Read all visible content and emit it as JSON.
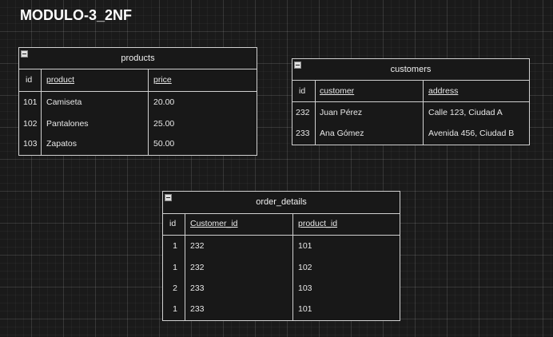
{
  "diagram_title": "MODULO-3_2NF",
  "tables": {
    "products": {
      "name": "products",
      "columns": [
        "id",
        "product",
        "price"
      ],
      "rows": [
        [
          "101",
          "Camiseta",
          "20.00"
        ],
        [
          "102",
          "Pantalones",
          "25.00"
        ],
        [
          "103",
          "Zapatos",
          "50.00"
        ]
      ]
    },
    "customers": {
      "name": "customers",
      "columns": [
        "id",
        "customer",
        "address"
      ],
      "rows": [
        [
          "232",
          "Juan Pérez",
          "Calle 123, Ciudad A"
        ],
        [
          "233",
          "Ana Gómez",
          "Avenida 456, Ciudad B"
        ]
      ]
    },
    "order_details": {
      "name": "order_details",
      "columns": [
        "id",
        "Customer_id",
        "product_id"
      ],
      "rows": [
        [
          "1",
          "232",
          "101"
        ],
        [
          "1",
          "232",
          "102"
        ],
        [
          "2",
          "233",
          "103"
        ],
        [
          "1",
          "233",
          "101"
        ]
      ]
    }
  }
}
